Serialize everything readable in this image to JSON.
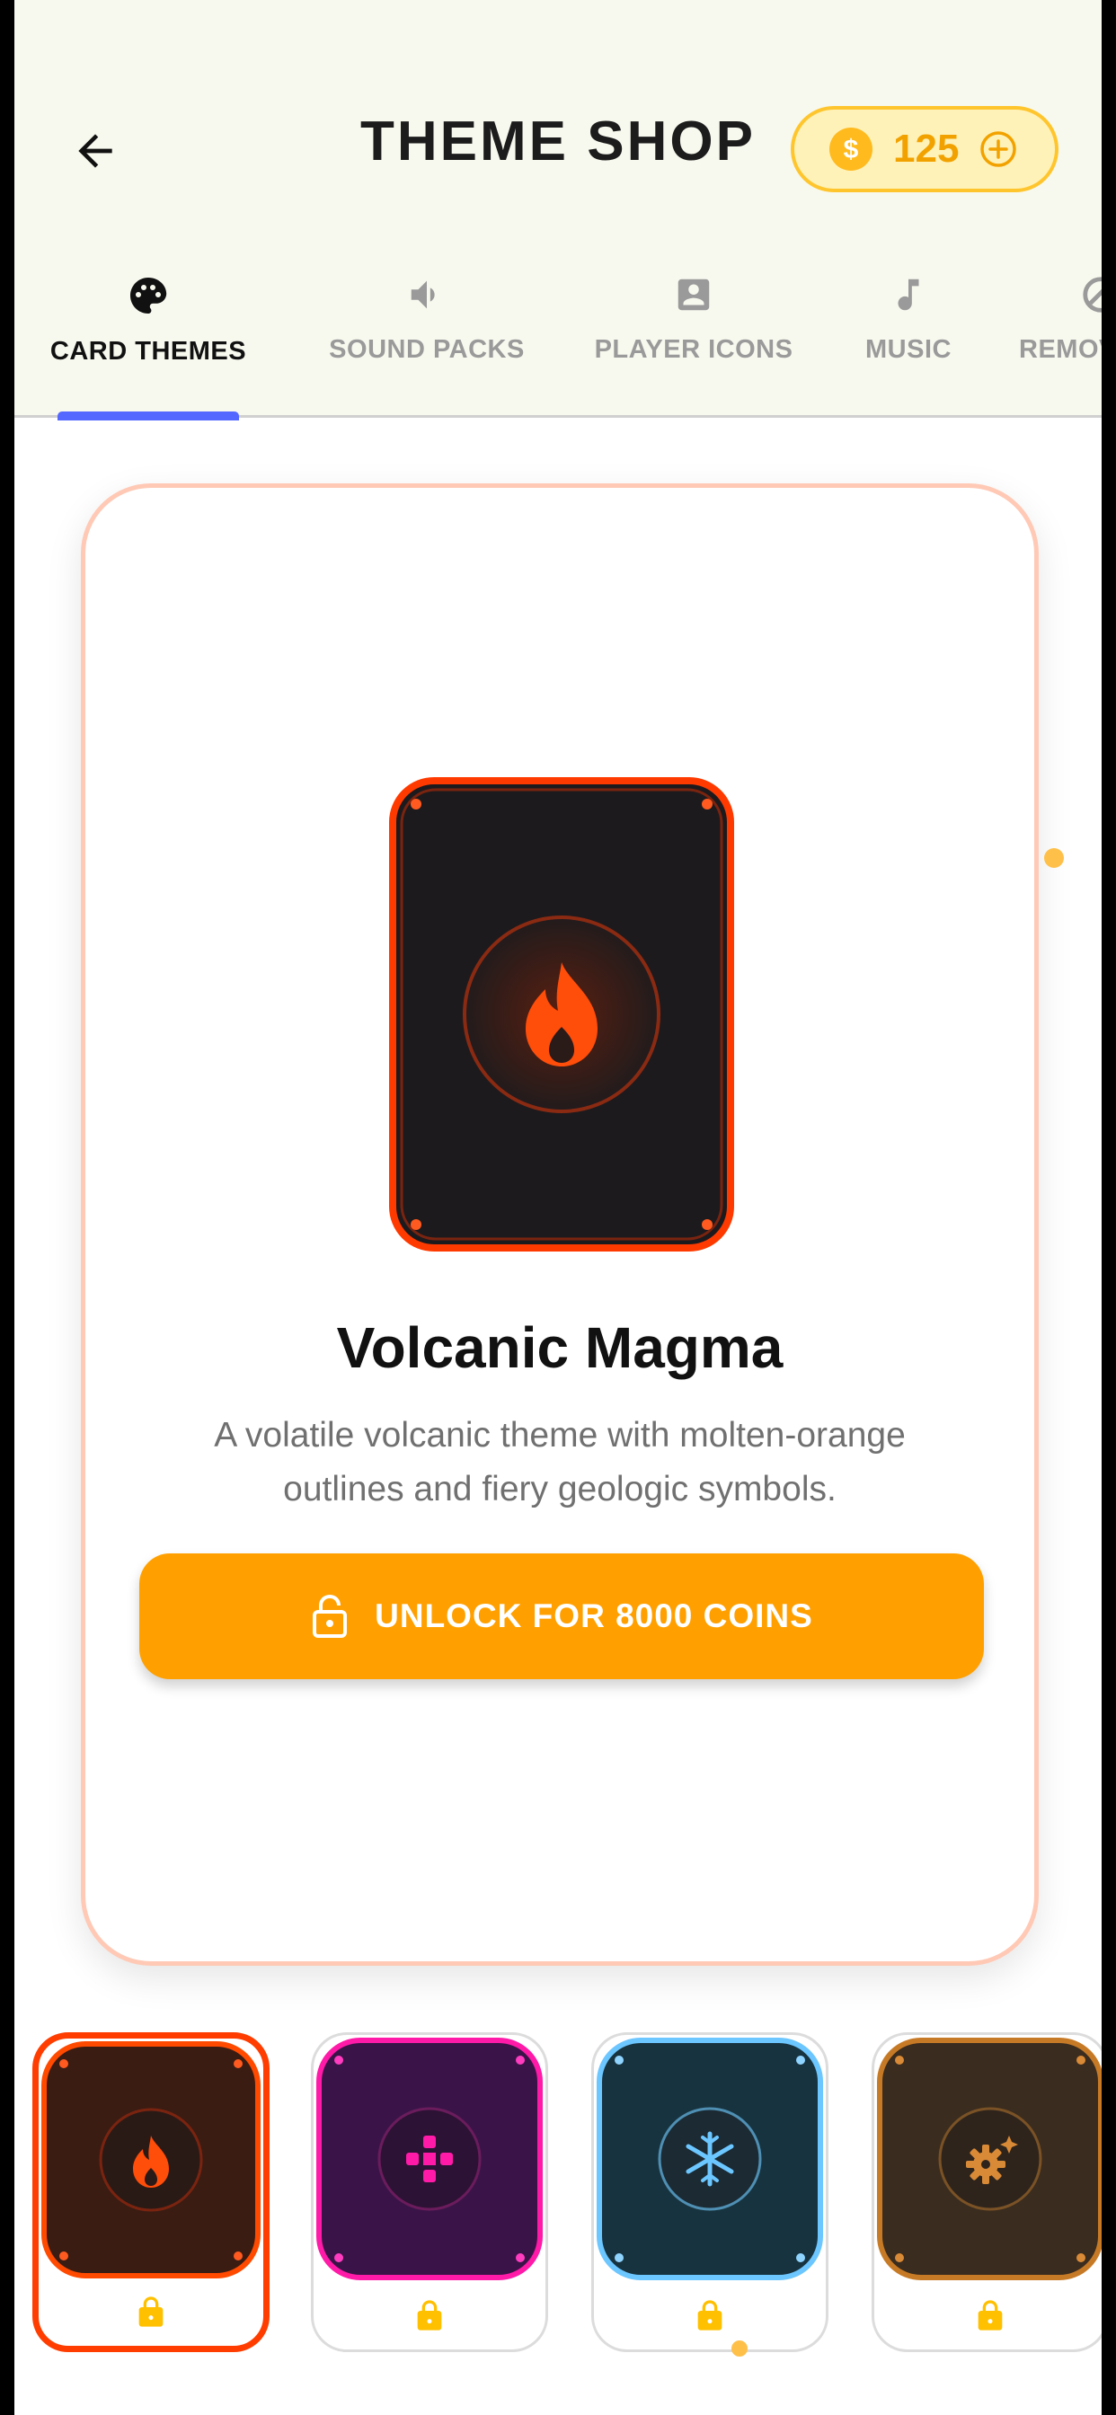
{
  "header": {
    "title": "THEME SHOP",
    "coins": "125"
  },
  "tabs": [
    {
      "label": "CARD THEMES",
      "icon": "palette-icon",
      "active": true
    },
    {
      "label": "SOUND PACKS",
      "icon": "speaker-icon",
      "active": false
    },
    {
      "label": "PLAYER ICONS",
      "icon": "portrait-icon",
      "active": false
    },
    {
      "label": "MUSIC",
      "icon": "music-note-icon",
      "active": false
    },
    {
      "label": "REMOV",
      "icon": "circle-icon",
      "active": false
    }
  ],
  "featured": {
    "name": "Volcanic Magma",
    "description": "A volatile volcanic theme with molten-orange outlines and fiery geologic symbols.",
    "unlock_label": "UNLOCK FOR 8000 COINS"
  },
  "themes": [
    {
      "icon": "flame-icon",
      "accent": "#ff4a00",
      "bg": "#3a1c12",
      "locked": true,
      "selected": true
    },
    {
      "icon": "gamepad-icon",
      "accent": "#ff1aa8",
      "bg": "#3a1448",
      "locked": true,
      "selected": false
    },
    {
      "icon": "snowflake-icon",
      "accent": "#6cc6ff",
      "bg": "#17333f",
      "locked": true,
      "selected": false
    },
    {
      "icon": "gear-sparkle-icon",
      "accent": "#c77a26",
      "bg": "#3a2c1e",
      "locked": true,
      "selected": false
    }
  ],
  "colors": {
    "accent": "#ffa000",
    "tab_indicator": "#5468ff",
    "coin": "#ffc52d"
  }
}
